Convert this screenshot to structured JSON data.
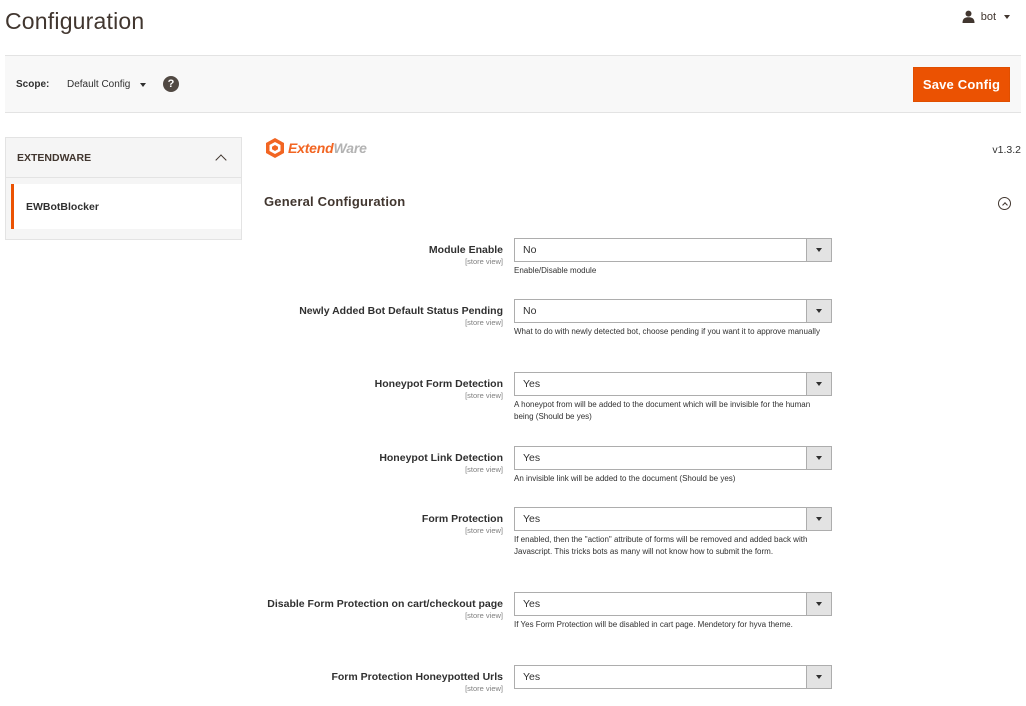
{
  "header": {
    "title": "Configuration",
    "user": "bot"
  },
  "scope": {
    "label": "Scope:",
    "value": "Default Config",
    "help": "?",
    "save_label": "Save Config"
  },
  "sidebar": {
    "section": "EXTENDWARE",
    "items": [
      {
        "label": "EWBotBlocker"
      }
    ]
  },
  "main": {
    "logo": {
      "part1": "Extend",
      "part2": "Ware"
    },
    "version": "v1.3.2",
    "section_title": "General Configuration",
    "fields": [
      {
        "label": "Module Enable",
        "scope": "[store view]",
        "value": "No",
        "note": "Enable/Disable module"
      },
      {
        "label": "Newly Added Bot Default Status Pending",
        "scope": "[store view]",
        "value": "No",
        "note": "What to do with newly detected bot, choose pending if you want it to approve manually"
      },
      {
        "label": "Honeypot Form Detection",
        "scope": "[store view]",
        "value": "Yes",
        "note": "A honeypot from will be added to the document which will be invisible for the human being (Should be yes)"
      },
      {
        "label": "Honeypot Link Detection",
        "scope": "[store view]",
        "value": "Yes",
        "note": "An invisible link will be added to the document (Should be yes)"
      },
      {
        "label": "Form Protection",
        "scope": "[store view]",
        "value": "Yes",
        "note": "If enabled, then the \"action\" attribute of forms will be removed and added back with Javascript. This tricks bots as many will not know how to submit the form."
      },
      {
        "label": "Disable Form Protection on cart/checkout page",
        "scope": "[store view]",
        "value": "Yes",
        "note": "If Yes Form Protection will be disabled in cart page. Mendetory for hyva theme."
      },
      {
        "label": "Form Protection Honeypotted Urls",
        "scope": "[store view]",
        "value": "Yes",
        "note": ""
      }
    ]
  },
  "colors": {
    "accent": "#eb5202",
    "text": "#303030",
    "title": "#41362f"
  }
}
